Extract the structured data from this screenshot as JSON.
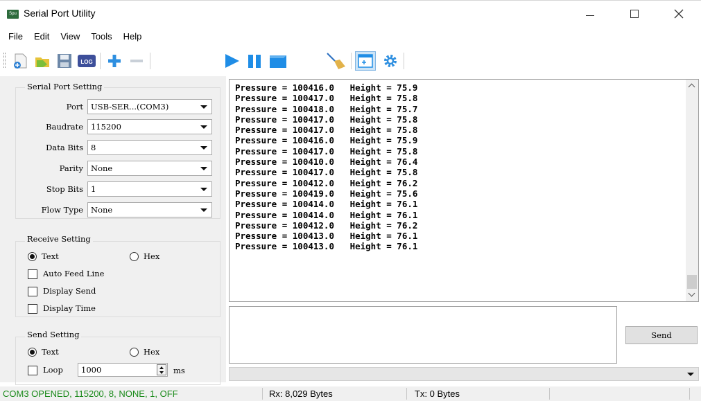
{
  "window": {
    "title": "Serial Port Utility",
    "icon_text": "Spu"
  },
  "menu": [
    "File",
    "Edit",
    "View",
    "Tools",
    "Help"
  ],
  "toolbar_icons": [
    "new-file-icon",
    "open-folder-icon",
    "save-icon",
    "log-icon",
    "add-icon",
    "remove-icon",
    "play-icon",
    "pause-icon",
    "stop-icon",
    "clear-broom-icon",
    "window-icon",
    "settings-gear-icon"
  ],
  "toolbar": {
    "log_text": "LOG"
  },
  "serial_port": {
    "title": "Serial Port Setting",
    "port_label": "Port",
    "port_value": "USB-SER...(COM3)",
    "baudrate_label": "Baudrate",
    "baudrate_value": "115200",
    "databits_label": "Data Bits",
    "databits_value": "8",
    "parity_label": "Parity",
    "parity_value": "None",
    "stopbits_label": "Stop Bits",
    "stopbits_value": "1",
    "flowtype_label": "Flow Type",
    "flowtype_value": "None"
  },
  "receive": {
    "title": "Receive Setting",
    "text_label": "Text",
    "hex_label": "Hex",
    "mode": "Text",
    "auto_feed_label": "Auto Feed Line",
    "display_send_label": "Display Send",
    "display_time_label": "Display Time"
  },
  "send": {
    "title": "Send Setting",
    "text_label": "Text",
    "hex_label": "Hex",
    "mode": "Text",
    "loop_label": "Loop",
    "loop_value": "1000",
    "unit": "ms",
    "button_label": "Send"
  },
  "received_lines": [
    "Pressure = 100416.0   Height = 75.9",
    "Pressure = 100417.0   Height = 75.8",
    "Pressure = 100418.0   Height = 75.7",
    "Pressure = 100417.0   Height = 75.8",
    "Pressure = 100417.0   Height = 75.8",
    "Pressure = 100416.0   Height = 75.9",
    "Pressure = 100417.0   Height = 75.8",
    "Pressure = 100410.0   Height = 76.4",
    "Pressure = 100417.0   Height = 75.8",
    "Pressure = 100412.0   Height = 76.2",
    "Pressure = 100419.0   Height = 75.6",
    "Pressure = 100414.0   Height = 76.1",
    "Pressure = 100414.0   Height = 76.1",
    "Pressure = 100412.0   Height = 76.2",
    "Pressure = 100413.0   Height = 76.1",
    "Pressure = 100413.0   Height = 76.1"
  ],
  "status": {
    "connection": "COM3 OPENED, 115200, 8, NONE, 1, OFF",
    "rx": "Rx: 8,029 Bytes",
    "tx": "Tx: 0 Bytes",
    "connection_color": "#1a8a1a"
  }
}
